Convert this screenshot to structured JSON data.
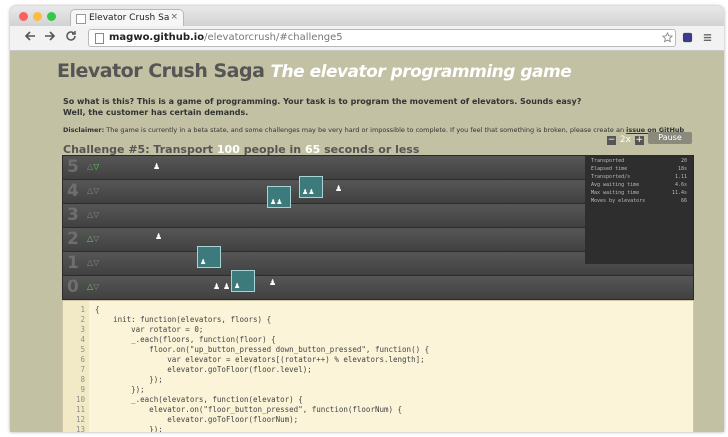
{
  "browser": {
    "tab_title": "Elevator Crush Saga - the",
    "tab_close": "×",
    "url_host": "magwo.github.io",
    "url_path": "/elevatorcrush/#challenge5",
    "back_icon": "arrow-left-icon",
    "forward_icon": "arrow-right-icon",
    "reload_icon": "reload-icon"
  },
  "page": {
    "title": "Elevator Crush Saga",
    "subtitle": "The elevator programming game",
    "intro_line1": "So what is this? This is a game of programming. Your task is to program the movement of elevators. Sounds easy?",
    "intro_line2": "Well, the customer has certain demands.",
    "disclaimer_label": "Disclaimer:",
    "disclaimer_text": " The game is currently in a beta state, and some challenges may be very hard or impossible to complete. If you feel that something is broken, please create an ",
    "disclaimer_link": "issue on GitHub"
  },
  "challenge": {
    "prefix": "Challenge #5: Transport ",
    "count": "100",
    "middle": " people in ",
    "seconds": "65",
    "suffix": " seconds or less"
  },
  "controls": {
    "speed_minus": "−",
    "speed_value": "2x",
    "speed_plus": "+",
    "pause_label": "Pause"
  },
  "floors": [
    {
      "number": "5",
      "up": "△",
      "down": "▽",
      "active": true
    },
    {
      "number": "4",
      "up": "△",
      "down": "▽",
      "active": false
    },
    {
      "number": "3",
      "up": "△",
      "down": "▽",
      "active": false
    },
    {
      "number": "2",
      "up": "△",
      "down": "▽",
      "active": true
    },
    {
      "number": "1",
      "up": "△",
      "down": "▽",
      "active": false
    },
    {
      "number": "0",
      "up": "△",
      "down": "▽",
      "active": true
    }
  ],
  "stats": [
    {
      "label": "Transported",
      "value": "20"
    },
    {
      "label": "Elapsed time",
      "value": "18s"
    },
    {
      "label": "Transported/s",
      "value": "1.11"
    },
    {
      "label": "Avg waiting time",
      "value": "4.6s"
    },
    {
      "label": "Max waiting time",
      "value": "11.4s"
    },
    {
      "label": "Moves by elevators",
      "value": "66"
    }
  ],
  "editor": {
    "lines": [
      {
        "n": "1",
        "text": "{"
      },
      {
        "n": "2",
        "text": "    init: function(elevators, floors) {"
      },
      {
        "n": "3",
        "text": "        var rotator = 0;"
      },
      {
        "n": "4",
        "text": "        _.each(floors, function(floor) {"
      },
      {
        "n": "5",
        "text": "            floor.on(\"up_button_pressed down_button_pressed\", function() {"
      },
      {
        "n": "6",
        "text": "                var elevator = elevators[(rotator++) % elevators.length];"
      },
      {
        "n": "7",
        "text": "                elevator.goToFloor(floor.level);"
      },
      {
        "n": "8",
        "text": "            });"
      },
      {
        "n": "9",
        "text": "        });"
      },
      {
        "n": "10",
        "text": "        _.each(elevators, function(elevator) {"
      },
      {
        "n": "11",
        "text": "            elevator.on(\"floor_button_pressed\", function(floorNum) {"
      },
      {
        "n": "12",
        "text": "                elevator.goToFloor(floorNum);"
      },
      {
        "n": "13",
        "text": "            });"
      }
    ]
  },
  "colors": {
    "page_bg": "#c2c1a3",
    "elevator": "#3d7a7c",
    "editor_bg": "#fbf4d8",
    "active_button": "#55dd55"
  }
}
